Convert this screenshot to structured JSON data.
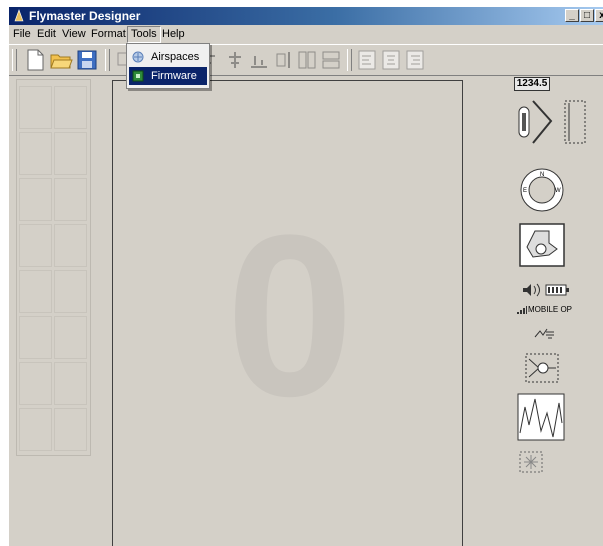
{
  "window": {
    "title": "Flymaster Designer"
  },
  "menubar": {
    "items": [
      "File",
      "Edit",
      "View",
      "Format",
      "Tools",
      "Help"
    ]
  },
  "tools_menu": {
    "items": [
      {
        "label": "Airspaces",
        "icon": "airspace-icon"
      },
      {
        "label": "Firmware",
        "icon": "chip-icon"
      }
    ]
  },
  "canvas": {
    "digit": "0"
  },
  "widgets": {
    "numeric_label": "1234.5",
    "sensor_label": "MOBILE OP"
  },
  "colors": {
    "title_start": "#0a246a",
    "title_end": "#a6caf0",
    "highlight": "#0a246a",
    "face": "#d4d0c8"
  }
}
